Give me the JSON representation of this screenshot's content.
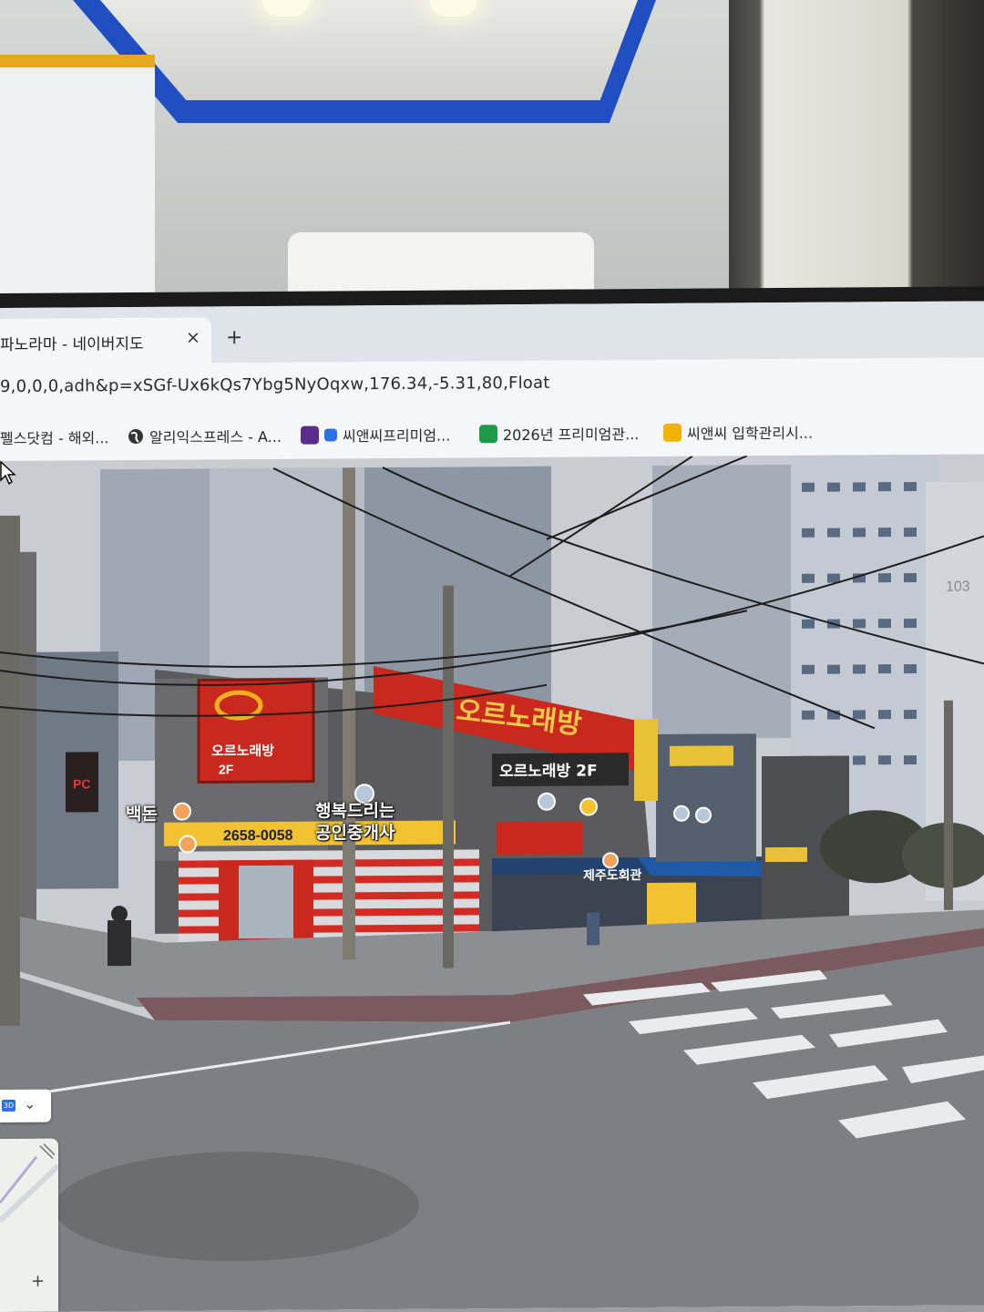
{
  "browser": {
    "tab_title": "파노라마 - 네이버지도",
    "tab_close": "×",
    "new_tab": "+",
    "url": "9,0,0,0,adh&p=xSGf-Ux6kQs7Ybg5NyOqxw,176.34,-5.31,80,Float"
  },
  "bookmarks": [
    {
      "label": "펠스닷컴 - 해외...",
      "icon": "globe-icon"
    },
    {
      "label": "알리익스프레스 - A...",
      "icon": "globe-icon"
    },
    {
      "label": "씨앤씨프리미엄...",
      "icon": "bookmark-favicon"
    },
    {
      "label": "2026년 프리미엄관...",
      "icon": "sheet-icon"
    },
    {
      "label": "씨앤씨 입학관리시...",
      "icon": "bookmark-favicon"
    }
  ],
  "streetview": {
    "labels": [
      {
        "text": "행복드리는"
      },
      {
        "text": "공인중개사"
      },
      {
        "text": "백돈"
      }
    ],
    "signs": {
      "karaoke_big": "오르노래방",
      "karaoke_floor": "2F",
      "karaoke_mid": "오르노래방 2F",
      "phone": "2658-0058",
      "restaurant": "제주도회관",
      "building_number": "103",
      "pc": "PC"
    },
    "control_3d": "3D",
    "zoom_plus": "+"
  },
  "colors": {
    "accent_blue": "#2d6fe6",
    "sign_red": "#c9281d",
    "sign_yellow": "#e8c234"
  }
}
